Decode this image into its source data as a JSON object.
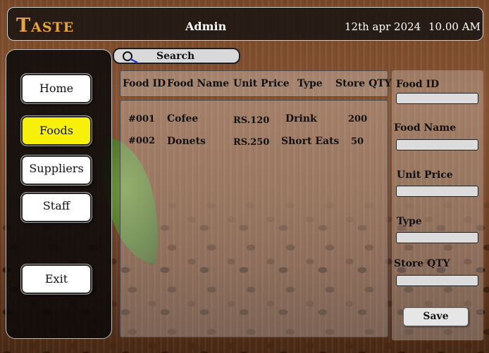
{
  "header": {
    "logo": "Taste",
    "user": "Admin",
    "date": "12th apr 2024",
    "time": "10.00 AM"
  },
  "sidebar": {
    "items": [
      {
        "label": "Home"
      },
      {
        "label": "Foods"
      },
      {
        "label": "Suppliers"
      },
      {
        "label": "Staff"
      },
      {
        "label": "Exit"
      }
    ],
    "active_color": "#f7f00a"
  },
  "search": {
    "label": "Search",
    "icon": "search-icon"
  },
  "table": {
    "columns": [
      "Food ID",
      "Food Name",
      "Unit Price",
      "Type",
      "Store QTY"
    ],
    "rows": [
      [
        "#001",
        "Cofee",
        "RS.120",
        "Drink",
        "200"
      ],
      [
        "#002",
        "Donets",
        "RS.250",
        "Short Eats",
        "50"
      ]
    ]
  },
  "form": {
    "labels": [
      "Food ID",
      "Food Name",
      "Unit Price",
      "Type",
      "Store QTY"
    ],
    "values": [
      "",
      "",
      "",
      "",
      ""
    ],
    "save_label": "Save"
  },
  "theme": {
    "logo_color": "#e8a33c",
    "panel_dark": "#0c0a0a"
  }
}
